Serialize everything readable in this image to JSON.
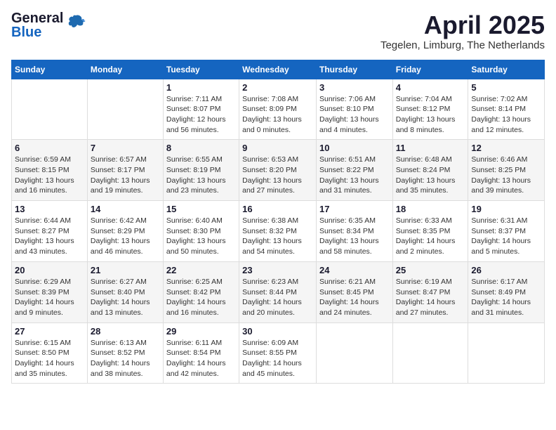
{
  "header": {
    "logo_general": "General",
    "logo_blue": "Blue",
    "title": "April 2025",
    "subtitle": "Tegelen, Limburg, The Netherlands"
  },
  "weekdays": [
    "Sunday",
    "Monday",
    "Tuesday",
    "Wednesday",
    "Thursday",
    "Friday",
    "Saturday"
  ],
  "weeks": [
    [
      {
        "day": "",
        "info": ""
      },
      {
        "day": "",
        "info": ""
      },
      {
        "day": "1",
        "info": "Sunrise: 7:11 AM\nSunset: 8:07 PM\nDaylight: 12 hours\nand 56 minutes."
      },
      {
        "day": "2",
        "info": "Sunrise: 7:08 AM\nSunset: 8:09 PM\nDaylight: 13 hours\nand 0 minutes."
      },
      {
        "day": "3",
        "info": "Sunrise: 7:06 AM\nSunset: 8:10 PM\nDaylight: 13 hours\nand 4 minutes."
      },
      {
        "day": "4",
        "info": "Sunrise: 7:04 AM\nSunset: 8:12 PM\nDaylight: 13 hours\nand 8 minutes."
      },
      {
        "day": "5",
        "info": "Sunrise: 7:02 AM\nSunset: 8:14 PM\nDaylight: 13 hours\nand 12 minutes."
      }
    ],
    [
      {
        "day": "6",
        "info": "Sunrise: 6:59 AM\nSunset: 8:15 PM\nDaylight: 13 hours\nand 16 minutes."
      },
      {
        "day": "7",
        "info": "Sunrise: 6:57 AM\nSunset: 8:17 PM\nDaylight: 13 hours\nand 19 minutes."
      },
      {
        "day": "8",
        "info": "Sunrise: 6:55 AM\nSunset: 8:19 PM\nDaylight: 13 hours\nand 23 minutes."
      },
      {
        "day": "9",
        "info": "Sunrise: 6:53 AM\nSunset: 8:20 PM\nDaylight: 13 hours\nand 27 minutes."
      },
      {
        "day": "10",
        "info": "Sunrise: 6:51 AM\nSunset: 8:22 PM\nDaylight: 13 hours\nand 31 minutes."
      },
      {
        "day": "11",
        "info": "Sunrise: 6:48 AM\nSunset: 8:24 PM\nDaylight: 13 hours\nand 35 minutes."
      },
      {
        "day": "12",
        "info": "Sunrise: 6:46 AM\nSunset: 8:25 PM\nDaylight: 13 hours\nand 39 minutes."
      }
    ],
    [
      {
        "day": "13",
        "info": "Sunrise: 6:44 AM\nSunset: 8:27 PM\nDaylight: 13 hours\nand 43 minutes."
      },
      {
        "day": "14",
        "info": "Sunrise: 6:42 AM\nSunset: 8:29 PM\nDaylight: 13 hours\nand 46 minutes."
      },
      {
        "day": "15",
        "info": "Sunrise: 6:40 AM\nSunset: 8:30 PM\nDaylight: 13 hours\nand 50 minutes."
      },
      {
        "day": "16",
        "info": "Sunrise: 6:38 AM\nSunset: 8:32 PM\nDaylight: 13 hours\nand 54 minutes."
      },
      {
        "day": "17",
        "info": "Sunrise: 6:35 AM\nSunset: 8:34 PM\nDaylight: 13 hours\nand 58 minutes."
      },
      {
        "day": "18",
        "info": "Sunrise: 6:33 AM\nSunset: 8:35 PM\nDaylight: 14 hours\nand 2 minutes."
      },
      {
        "day": "19",
        "info": "Sunrise: 6:31 AM\nSunset: 8:37 PM\nDaylight: 14 hours\nand 5 minutes."
      }
    ],
    [
      {
        "day": "20",
        "info": "Sunrise: 6:29 AM\nSunset: 8:39 PM\nDaylight: 14 hours\nand 9 minutes."
      },
      {
        "day": "21",
        "info": "Sunrise: 6:27 AM\nSunset: 8:40 PM\nDaylight: 14 hours\nand 13 minutes."
      },
      {
        "day": "22",
        "info": "Sunrise: 6:25 AM\nSunset: 8:42 PM\nDaylight: 14 hours\nand 16 minutes."
      },
      {
        "day": "23",
        "info": "Sunrise: 6:23 AM\nSunset: 8:44 PM\nDaylight: 14 hours\nand 20 minutes."
      },
      {
        "day": "24",
        "info": "Sunrise: 6:21 AM\nSunset: 8:45 PM\nDaylight: 14 hours\nand 24 minutes."
      },
      {
        "day": "25",
        "info": "Sunrise: 6:19 AM\nSunset: 8:47 PM\nDaylight: 14 hours\nand 27 minutes."
      },
      {
        "day": "26",
        "info": "Sunrise: 6:17 AM\nSunset: 8:49 PM\nDaylight: 14 hours\nand 31 minutes."
      }
    ],
    [
      {
        "day": "27",
        "info": "Sunrise: 6:15 AM\nSunset: 8:50 PM\nDaylight: 14 hours\nand 35 minutes."
      },
      {
        "day": "28",
        "info": "Sunrise: 6:13 AM\nSunset: 8:52 PM\nDaylight: 14 hours\nand 38 minutes."
      },
      {
        "day": "29",
        "info": "Sunrise: 6:11 AM\nSunset: 8:54 PM\nDaylight: 14 hours\nand 42 minutes."
      },
      {
        "day": "30",
        "info": "Sunrise: 6:09 AM\nSunset: 8:55 PM\nDaylight: 14 hours\nand 45 minutes."
      },
      {
        "day": "",
        "info": ""
      },
      {
        "day": "",
        "info": ""
      },
      {
        "day": "",
        "info": ""
      }
    ]
  ]
}
